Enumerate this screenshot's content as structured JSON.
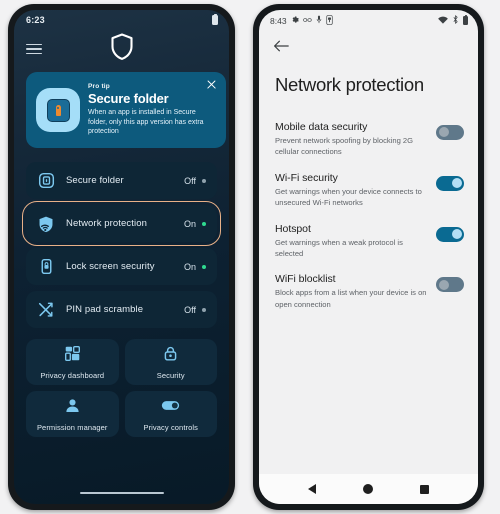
{
  "left_phone": {
    "status_bar": {
      "time": "6:23",
      "battery_icon": "battery-icon"
    },
    "top_bar": {
      "menu_icon": "hamburger-menu-icon",
      "logo_icon": "shield-icon"
    },
    "pro_tip_card": {
      "eyebrow": "Pro tip",
      "title": "Secure folder",
      "description": "When an app is installed in Secure folder, only this app version has extra protection",
      "close_icon": "close-icon",
      "thumbnail_icon": "secure-folder-key-icon",
      "bg_color": "#0d5a7d"
    },
    "settings_rows": [
      {
        "icon": "secure-folder-icon",
        "label": "Secure folder",
        "state": "Off",
        "on": false
      },
      {
        "icon": "network-protection-icon",
        "label": "Network protection",
        "state": "On",
        "on": true,
        "selected": true
      },
      {
        "icon": "lock-screen-icon",
        "label": "Lock screen security",
        "state": "On",
        "on": true
      },
      {
        "icon": "shuffle-arrows-icon",
        "label": "PIN pad scramble",
        "state": "Off",
        "on": false
      }
    ],
    "tiles": [
      {
        "icon": "dashboard-grid-icon",
        "label": "Privacy dashboard"
      },
      {
        "icon": "padlock-icon",
        "label": "Security"
      },
      {
        "icon": "person-icon",
        "label": "Permission manager"
      },
      {
        "icon": "toggle-switch-icon",
        "label": "Privacy controls"
      }
    ],
    "selection_highlight_color": "#e8b188",
    "on_dot_color": "#2fd98f",
    "off_dot_color": "#8fa2ad",
    "home_indicator": "home-indicator"
  },
  "right_phone": {
    "status_bar": {
      "time": "8:43",
      "left_icons": [
        "gear-icon",
        "link-icon",
        "microphone-icon",
        "vpn-key-icon"
      ],
      "right_icons": [
        "wifi-icon",
        "bluetooth-icon",
        "battery-icon"
      ]
    },
    "back_icon": "back-arrow-icon",
    "page_title": "Network protection",
    "settings": [
      {
        "title": "Mobile data security",
        "description": "Prevent network spoofing by blocking 2G cellular connections",
        "toggle_state": "off"
      },
      {
        "title": "Wi-Fi security",
        "description": "Get warnings when your device connects to unsecured Wi-Fi networks",
        "toggle_state": "on"
      },
      {
        "title": "Hotspot",
        "description": "Get warnings when a weak protocol is selected",
        "toggle_state": "on"
      },
      {
        "title": "WiFi blocklist",
        "description": "Block apps from a list when your device is on open connection",
        "toggle_state": "off"
      }
    ],
    "nav_bar": {
      "back_icon": "nav-back-triangle-icon",
      "home_icon": "nav-home-circle-icon",
      "recents_icon": "nav-recents-square-icon"
    },
    "toggle_on_color": "#0a6a92",
    "toggle_off_color": "#5f788a"
  }
}
